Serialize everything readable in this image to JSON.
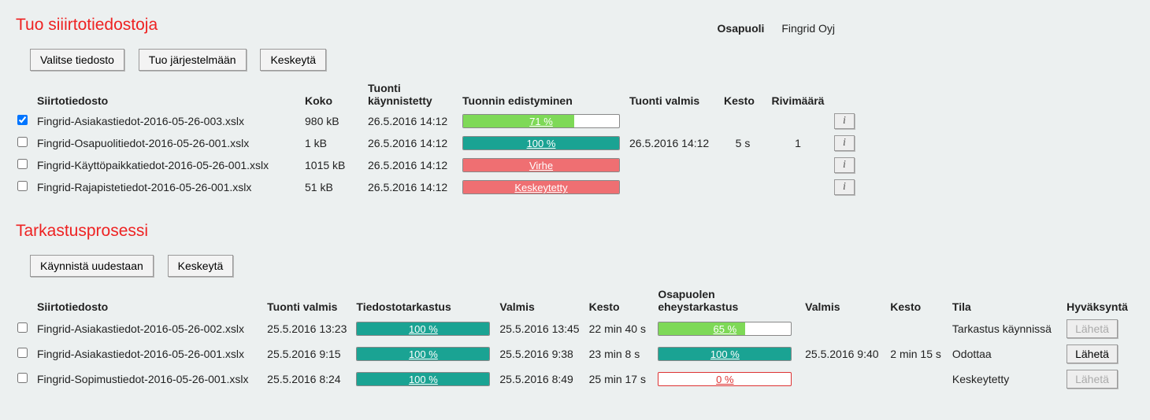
{
  "party": {
    "label": "Osapuoli",
    "value": "Fingrid Oyj"
  },
  "section1": {
    "title": "Tuo siiirtotiedostoja",
    "buttons": {
      "select": "Valitse tiedosto",
      "import": "Tuo järjestelmään",
      "cancel": "Keskeytä"
    },
    "headers": {
      "file": "Siirtotiedosto",
      "size": "Koko",
      "started": "Tuonti käynnistetty",
      "progress": "Tuonnin edistyminen",
      "done": "Tuonti valmis",
      "dur": "Kesto",
      "rows": "Rivimäärä"
    },
    "rows": [
      {
        "checked": true,
        "file": "Fingrid-Asiakastiedot-2016-05-26-003.xslx",
        "size": "980 kB",
        "started": "26.5.2016 14:12",
        "ptext": "71 %",
        "pstyle": "green",
        "ppct": 71,
        "done": "",
        "dur": "",
        "rows": ""
      },
      {
        "checked": false,
        "file": "Fingrid-Osapuolitiedot-2016-05-26-001.xslx",
        "size": "1 kB",
        "started": "26.5.2016 14:12",
        "ptext": "100 %",
        "pstyle": "teal",
        "ppct": 100,
        "done": "26.5.2016 14:12",
        "dur": "5 s",
        "rows": "1"
      },
      {
        "checked": false,
        "file": "Fingrid-Käyttöpaikkatiedot-2016-05-26-001.xslx",
        "size": "1015 kB",
        "started": "26.5.2016 14:12",
        "ptext": "Virhe",
        "pstyle": "red",
        "ppct": 100,
        "done": "",
        "dur": "",
        "rows": ""
      },
      {
        "checked": false,
        "file": "Fingrid-Rajapistetiedot-2016-05-26-001.xslx",
        "size": "51 kB",
        "started": "26.5.2016 14:12",
        "ptext": "Keskeytetty",
        "pstyle": "red",
        "ppct": 100,
        "done": "",
        "dur": "",
        "rows": ""
      }
    ]
  },
  "section2": {
    "title": "Tarkastusprosessi",
    "buttons": {
      "restart": "Käynnistä uudestaan",
      "cancel": "Keskeytä"
    },
    "headers": {
      "file": "Siirtotiedosto",
      "done": "Tuonti valmis",
      "filecheck": "Tiedostotarkastus",
      "ready": "Valmis",
      "dur": "Kesto",
      "integ": "Osapuolen eheystarkastus",
      "ready2": "Valmis",
      "dur2": "Kesto",
      "state": "Tila",
      "approve": "Hyväksyntä"
    },
    "sendLabel": "Lähetä",
    "rows": [
      {
        "checked": false,
        "file": "Fingrid-Asiakastiedot-2016-05-26-002.xslx",
        "done": "25.5.2016 13:23",
        "fc_text": "100 %",
        "fc_pct": 100,
        "ready": "25.5.2016 13:45",
        "dur": "22 min 40 s",
        "int_text": "65 %",
        "int_style": "green",
        "int_pct": 65,
        "ready2": "",
        "dur2": "",
        "state": "Tarkastus käynnissä",
        "sendEnabled": false
      },
      {
        "checked": false,
        "file": "Fingrid-Asiakastiedot-2016-05-26-001.xslx",
        "done": "25.5.2016 9:15",
        "fc_text": "100 %",
        "fc_pct": 100,
        "ready": "25.5.2016 9:38",
        "dur": "23 min 8 s",
        "int_text": "100 %",
        "int_style": "teal",
        "int_pct": 100,
        "ready2": "25.5.2016 9:40",
        "dur2": "2 min 15 s",
        "state": "Odottaa",
        "sendEnabled": true
      },
      {
        "checked": false,
        "file": "Fingrid-Sopimustiedot-2016-05-26-001.xslx",
        "done": "25.5.2016 8:24",
        "fc_text": "100 %",
        "fc_pct": 100,
        "ready": "25.5.2016 8:49",
        "dur": "25 min 17 s",
        "int_text": "0 %",
        "int_style": "outline",
        "int_pct": 0,
        "ready2": "",
        "dur2": "",
        "state": "Keskeytetty",
        "sendEnabled": false
      }
    ]
  }
}
